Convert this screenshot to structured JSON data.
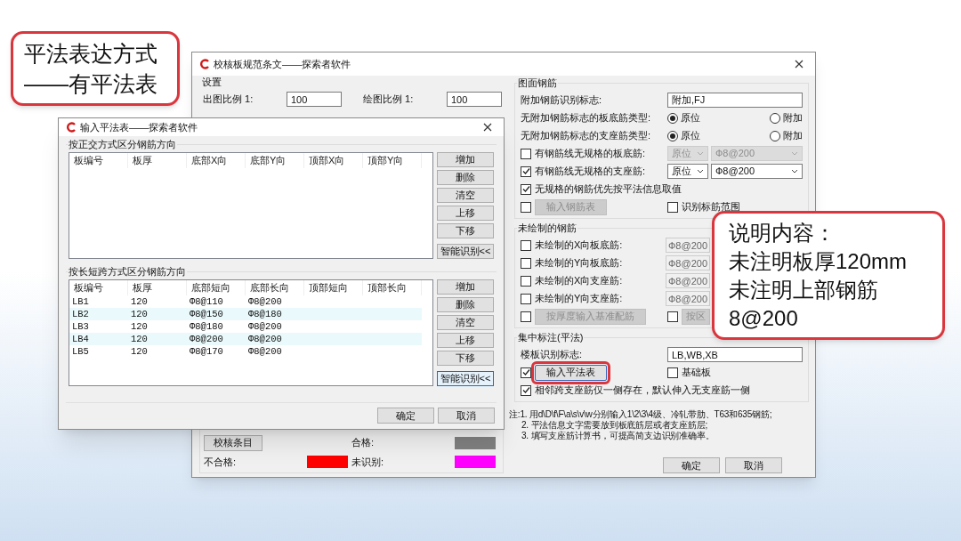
{
  "callout_top": {
    "lines": [
      "平法表达方式",
      "——有平法表"
    ]
  },
  "main_window": {
    "title": "校核板规范条文——探索者软件",
    "settings": {
      "title": "设置",
      "fields": [
        {
          "label": "出图比例 1:",
          "value": "100"
        },
        {
          "label": "绘图比例 1:",
          "value": "100"
        }
      ]
    },
    "check_item_button": "校核条目",
    "legend": [
      {
        "label": "合格:",
        "color": "#808080"
      },
      {
        "label": "不合格:",
        "color": "#ff0000"
      },
      {
        "label": "未识别:",
        "color": "#ff00ff"
      }
    ],
    "sections": [
      {
        "title": "图面钢筋",
        "rows": [
          {
            "kind": "field",
            "label": "附加钢筋识别标志:",
            "value": "附加,FJ"
          },
          {
            "kind": "radio",
            "label": "无附加钢筋标志的板底筋类型:",
            "options": [
              {
                "label": "原位",
                "selected": true
              },
              {
                "label": "附加",
                "selected": false
              }
            ]
          },
          {
            "kind": "radio",
            "label": "无附加钢筋标志的支座筋类型:",
            "options": [
              {
                "label": "原位",
                "selected": true
              },
              {
                "label": "附加",
                "selected": false
              }
            ]
          },
          {
            "kind": "check_combo",
            "label": "有钢筋线无规格的板底筋:",
            "checked": false,
            "combos": [
              {
                "value": "原位",
                "disabled": true
              },
              {
                "value": "Ф8@200",
                "disabled": true
              }
            ]
          },
          {
            "kind": "check_combo",
            "label": "有钢筋线无规格的支座筋:",
            "checked": true,
            "combos": [
              {
                "value": "原位",
                "disabled": false
              },
              {
                "value": "Ф8@200",
                "disabled": false
              }
            ]
          },
          {
            "kind": "check",
            "label": "无规格的钢筋优先按平法信息取值",
            "checked": true
          },
          {
            "kind": "pair",
            "items": [
              {
                "kind": "check_button",
                "checked": false,
                "button": "输入钢筋表",
                "disabled": true,
                "highlighted": false
              },
              {
                "kind": "check",
                "label": "识别标筋范围",
                "checked": false
              }
            ]
          }
        ]
      },
      {
        "title": "未绘制的钢筋",
        "rows": [
          {
            "kind": "check_field",
            "label": "未绘制的X向板底筋:",
            "checked": false,
            "value": "Ф8@200",
            "disabled": true
          },
          {
            "kind": "check_field",
            "label": "未绘制的Y向板底筋:",
            "checked": false,
            "value": "Ф8@200",
            "disabled": true
          },
          {
            "kind": "check_field",
            "label": "未绘制的X向支座筋:",
            "checked": false,
            "value": "Ф8@200",
            "disabled": true
          },
          {
            "kind": "check_field",
            "label": "未绘制的Y向支座筋:",
            "checked": false,
            "value": "Ф8@200",
            "disabled": true
          },
          {
            "kind": "pair",
            "items": [
              {
                "kind": "check_button",
                "checked": false,
                "button": "按厚度输入基准配筋",
                "disabled": true,
                "highlighted": false
              },
              {
                "kind": "check_button",
                "checked": false,
                "button": "按区",
                "disabled": true,
                "highlighted": false
              }
            ]
          }
        ]
      },
      {
        "title": "集中标注(平法)",
        "rows": [
          {
            "kind": "field",
            "label": "楼板识别标志:",
            "value": "LB,WB,XB"
          },
          {
            "kind": "pair",
            "items": [
              {
                "kind": "check_button",
                "checked": true,
                "button": "输入平法表",
                "disabled": false,
                "highlighted": true
              },
              {
                "kind": "check",
                "label": "基础板",
                "checked": false
              }
            ]
          },
          {
            "kind": "check",
            "label": "相邻跨支座筋仅一侧存在，默认伸入无支座筋一侧",
            "checked": true
          }
        ]
      }
    ],
    "notes": [
      "注:1. 用d\\D\\f\\F\\a\\s\\v\\w分别输入1\\2\\3\\4级、冷轧带肋、T63和635钢筋;",
      "2. 平法信息文字需要放到板底筋层或者支座筋层;",
      "3. 填写支座筋计算书，可提高简支边识别准确率。"
    ],
    "buttons": [
      "确定",
      "取消"
    ]
  },
  "input_dialog": {
    "title": "输入平法表——探索者软件",
    "groups": [
      {
        "title": "按正交方式区分钢筋方向",
        "columns": [
          "板编号",
          "板厚",
          "底部X向",
          "底部Y向",
          "顶部X向",
          "顶部Y向"
        ],
        "buttons": [
          {
            "label": "增加",
            "focused": false
          },
          {
            "label": "删除",
            "focused": false
          },
          {
            "label": "清空",
            "focused": false
          },
          {
            "label": "上移",
            "focused": false
          },
          {
            "label": "下移",
            "focused": false
          },
          {
            "label": "智能识别<<",
            "focused": false
          }
        ]
      },
      {
        "title": "按长短跨方式区分钢筋方向",
        "columns": [
          "板编号",
          "板厚",
          "底部短向",
          "底部长向",
          "顶部短向",
          "顶部长向"
        ],
        "rows": [
          [
            "LB1",
            "120",
            "Ф8@110",
            "Ф8@200"
          ],
          [
            "LB2",
            "120",
            "Ф8@150",
            "Ф8@180"
          ],
          [
            "LB3",
            "120",
            "Ф8@180",
            "Ф8@200"
          ],
          [
            "LB4",
            "120",
            "Ф8@200",
            "Ф8@200"
          ],
          [
            "LB5",
            "120",
            "Ф8@170",
            "Ф8@200"
          ]
        ],
        "buttons": [
          {
            "label": "增加",
            "focused": false
          },
          {
            "label": "删除",
            "focused": false
          },
          {
            "label": "清空",
            "focused": false
          },
          {
            "label": "上移",
            "focused": false
          },
          {
            "label": "下移",
            "focused": false
          },
          {
            "label": "智能识别<<",
            "focused": true
          }
        ]
      }
    ],
    "footer_buttons": [
      "确定",
      "取消"
    ]
  },
  "callout_note": {
    "lines": [
      "说明内容：",
      "未注明板厚120mm",
      "未注明上部钢筋",
      "8@200"
    ]
  }
}
